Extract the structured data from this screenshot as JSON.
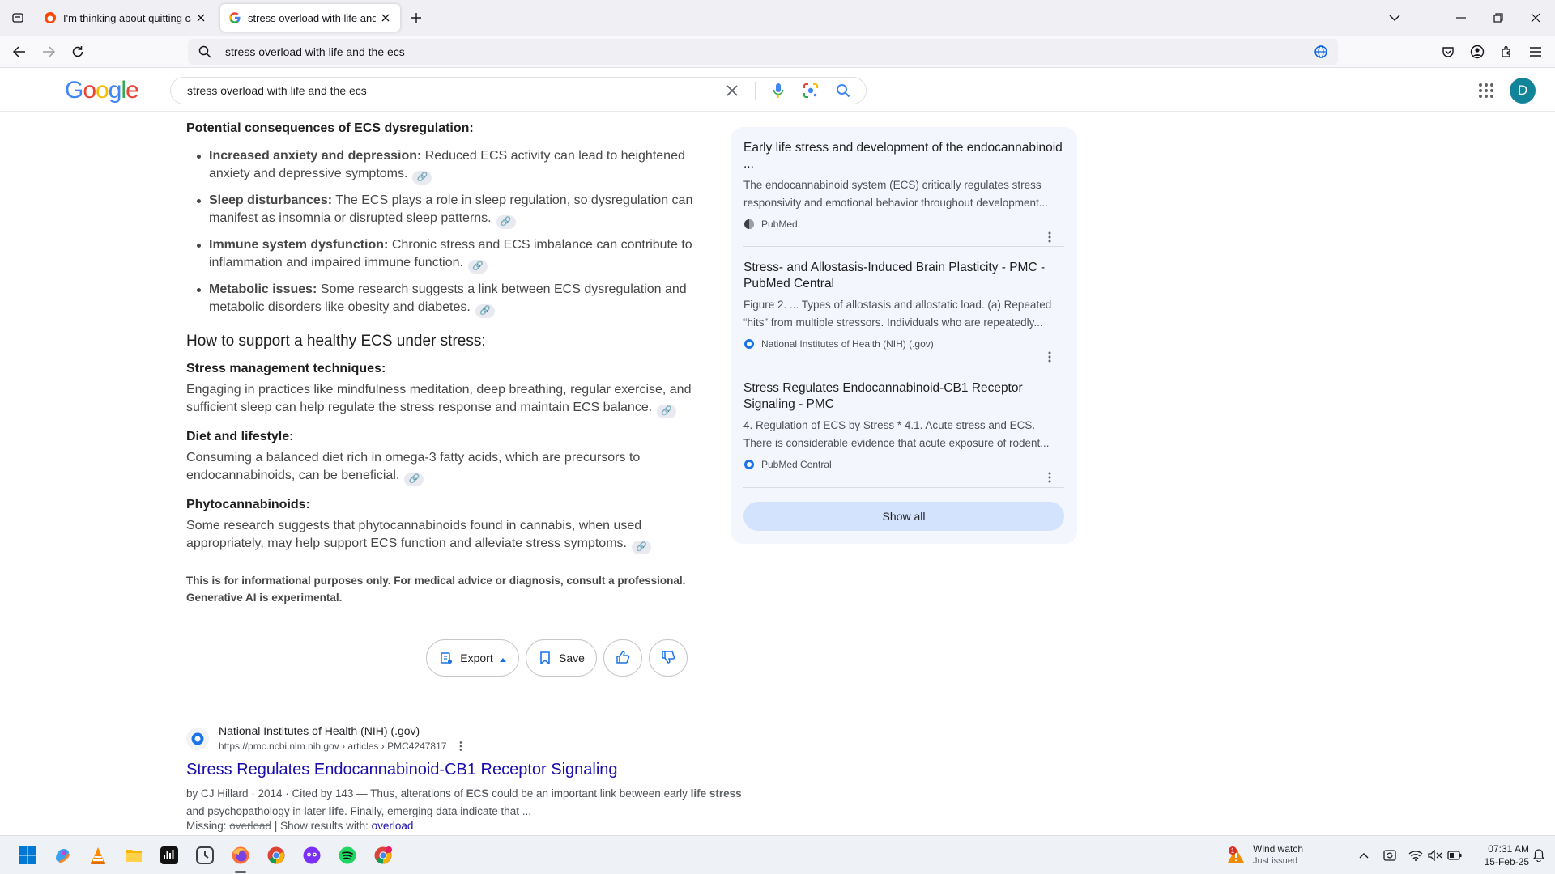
{
  "browser": {
    "tabs": [
      {
        "title": "I'm thinking about quitting cannabis",
        "active": false
      },
      {
        "title": "stress overload with life and the ecs - Google Search",
        "active": true
      }
    ],
    "url": "stress overload with life and the ecs"
  },
  "google": {
    "query": "stress overload with life and the ecs",
    "avatar_letter": "D"
  },
  "ai_overview": {
    "consequences_heading": "Potential consequences of ECS dysregulation:",
    "consequences": [
      {
        "label": "Increased anxiety and depression:",
        "text": " Reduced ECS activity can lead to heightened anxiety and depressive symptoms."
      },
      {
        "label": "Sleep disturbances:",
        "text": " The ECS plays a role in sleep regulation, so dysregulation can manifest as insomnia or disrupted sleep patterns."
      },
      {
        "label": "Immune system dysfunction:",
        "text": " Chronic stress and ECS imbalance can contribute to inflammation and impaired immune function."
      },
      {
        "label": "Metabolic issues:",
        "text": " Some research suggests a link between ECS dysregulation and metabolic disorders like obesity and diabetes."
      }
    ],
    "support_heading": "How to support a healthy ECS under stress:",
    "sections": [
      {
        "heading": "Stress management techniques:",
        "text": "Engaging in practices like mindfulness meditation, deep breathing, regular exercise, and sufficient sleep can help regulate the stress response and maintain ECS balance."
      },
      {
        "heading": "Diet and lifestyle:",
        "text": "Consuming a balanced diet rich in omega-3 fatty acids, which are precursors to endocannabinoids, can be beneficial."
      },
      {
        "heading": "Phytocannabinoids:",
        "text": "Some research suggests that phytocannabinoids found in cannabis, when used appropriately, may help support ECS function and alleviate stress symptoms."
      }
    ],
    "disclaimer_1": "This is for informational purposes only. For medical advice or diagnosis, consult a professional.",
    "disclaimer_2": "Generative AI is experimental.",
    "actions": {
      "export": "Export",
      "save": "Save"
    }
  },
  "sources": [
    {
      "title": "Early life stress and development of the endocannabinoid ...",
      "desc": "The endocannabinoid system (ECS) critically regulates stress responsivity and emotional behavior throughout development...",
      "site": "PubMed"
    },
    {
      "title": "Stress- and Allostasis-Induced Brain Plasticity - PMC - PubMed Central",
      "desc": "Figure 2. ... Types of allostasis and allostatic load. (a) Repeated “hits” from multiple stressors. Individuals who are repeatedly...",
      "site": "National Institutes of Health (NIH) (.gov)"
    },
    {
      "title": "Stress Regulates Endocannabinoid-CB1 Receptor Signaling - PMC",
      "desc": "4. Regulation of ECS by Stress * 4.1. Acute stress and ECS. There is considerable evidence that acute exposure of rodent...",
      "site": "PubMed Central"
    }
  ],
  "show_all": "Show all",
  "result": {
    "site": "National Institutes of Health (NIH) (.gov)",
    "url": "https://pmc.ncbi.nlm.nih.gov › articles › PMC4247817",
    "title": "Stress Regulates Endocannabinoid-CB1 Receptor Signaling",
    "snippet_meta": "by CJ Hillard · 2014 · Cited by 143 — Thus, alterations of ",
    "snippet_b1": "ECS",
    "snippet_mid": " could be an important link between early ",
    "snippet_b2": "life stress",
    "snippet_mid2": " and psychopathology in later ",
    "snippet_b3": "life",
    "snippet_end": ". Finally, emerging data indicate that ...",
    "missing_label": "Missing: ",
    "missing_word": "overload",
    "show_with": " | Show results with: ",
    "show_with_word": "overload"
  },
  "taskbar": {
    "weather_title": "Wind watch",
    "weather_sub": "Just issued",
    "weather_badge": "1",
    "time": "07:31 AM",
    "date": "15-Feb-25"
  },
  "colors": {
    "google_blue": "#4285f4",
    "google_red": "#ea4335",
    "google_yellow": "#fbbc05",
    "google_green": "#34a853",
    "link": "#1a0dab",
    "panel_bg": "#f3f6fc",
    "avatar": "#12849a"
  }
}
